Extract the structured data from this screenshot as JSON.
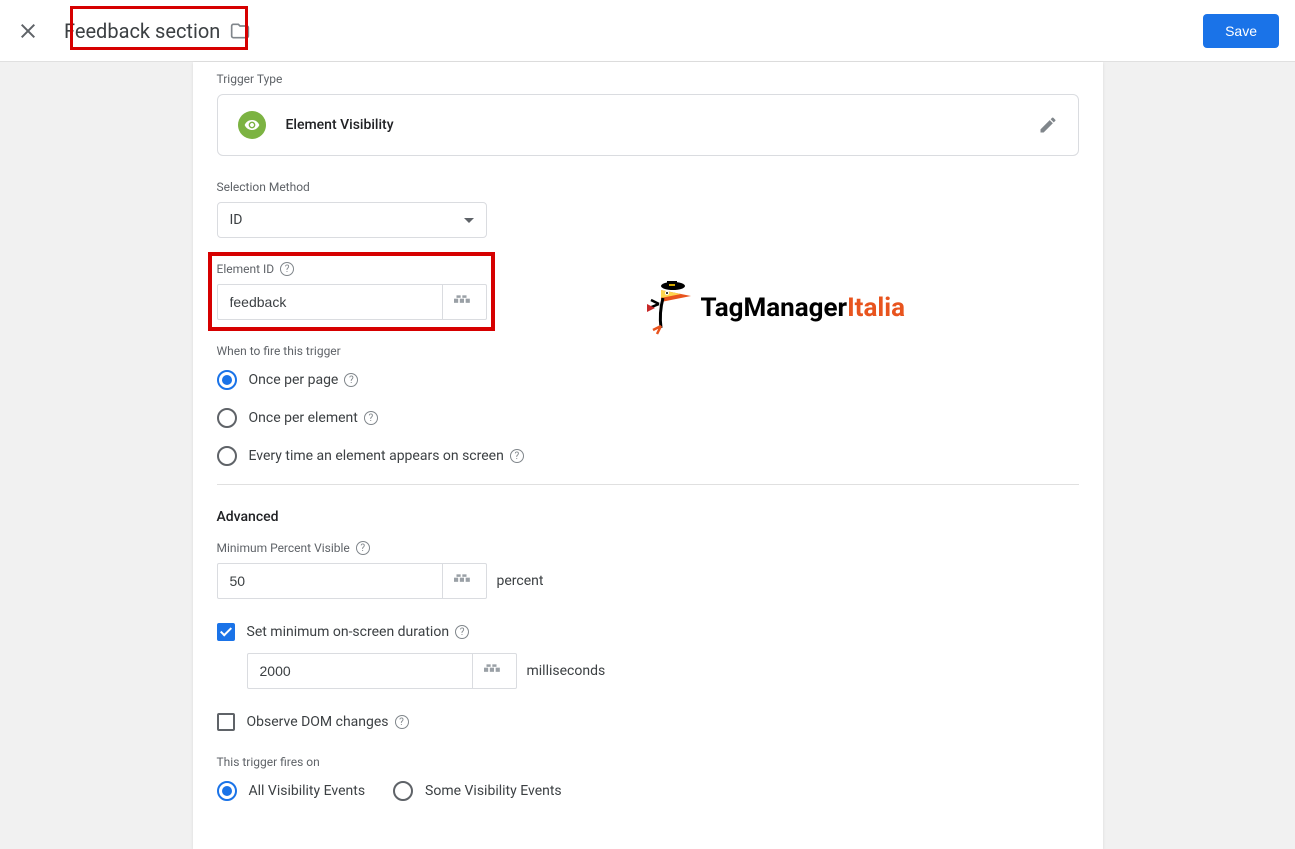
{
  "header": {
    "title": "Feedback section",
    "saveLabel": "Save"
  },
  "triggerTypeLabel": "Trigger Type",
  "triggerTypeName": "Element Visibility",
  "selectionMethod": {
    "label": "Selection Method",
    "value": "ID"
  },
  "elementId": {
    "label": "Element ID",
    "value": "feedback"
  },
  "whenToFire": {
    "label": "When to fire this trigger",
    "options": {
      "perPage": "Once per page",
      "perElement": "Once per element",
      "everyTime": "Every time an element appears on screen"
    },
    "selected": "perPage"
  },
  "advanced": {
    "title": "Advanced",
    "minPercent": {
      "label": "Minimum Percent Visible",
      "value": "50",
      "unit": "percent"
    },
    "minDuration": {
      "label": "Set minimum on-screen duration",
      "checked": true,
      "value": "2000",
      "unit": "milliseconds"
    },
    "observeDom": {
      "label": "Observe DOM changes",
      "checked": false
    }
  },
  "firesOn": {
    "label": "This trigger fires on",
    "options": {
      "all": "All Visibility Events",
      "some": "Some Visibility Events"
    },
    "selected": "all"
  },
  "brand": {
    "part1": "TagManager",
    "part2": "Italia"
  }
}
